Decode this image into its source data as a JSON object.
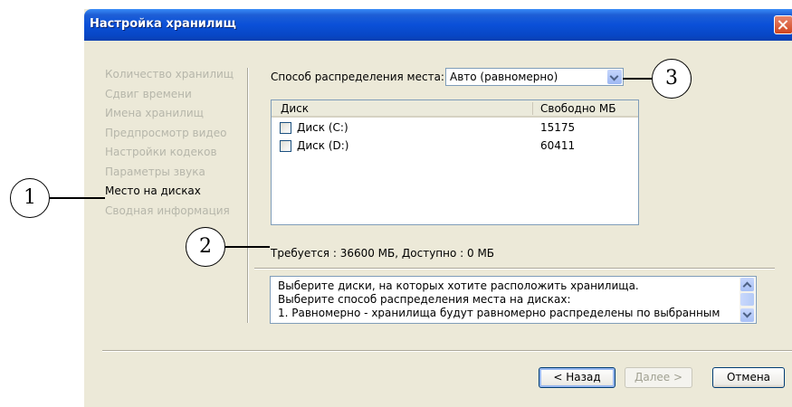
{
  "window": {
    "title": "Настройка хранилищ"
  },
  "steps": [
    {
      "label": "Количество хранилищ",
      "active": false
    },
    {
      "label": "Сдвиг времени",
      "active": false
    },
    {
      "label": "Имена хранилищ",
      "active": false
    },
    {
      "label": "Предпросмотр видео",
      "active": false
    },
    {
      "label": "Настройки кодеков",
      "active": false
    },
    {
      "label": "Параметры звука",
      "active": false
    },
    {
      "label": "Место на дисках",
      "active": true
    },
    {
      "label": "Сводная информация",
      "active": false
    }
  ],
  "distribution": {
    "label": "Способ распределения места:",
    "value": "Авто (равномерно)"
  },
  "disk_table": {
    "columns": [
      "Диск",
      "Свободно МБ"
    ],
    "rows": [
      {
        "name": "Диск (C:)",
        "free": "15175",
        "checked": false
      },
      {
        "name": "Диск (D:)",
        "free": "60411",
        "checked": false
      }
    ]
  },
  "status": "Требуется : 36600 МБ, Доступно : 0 МБ",
  "hint_lines": [
    "Выберите диски, на которых хотите расположить хранилища.",
    "Выберите способ распределения места на дисках:",
    "1. Равномерно - хранилища будут равномерно распределены по выбранным"
  ],
  "buttons": {
    "back": "< Назад",
    "next": "Далее >",
    "cancel": "Отмена"
  },
  "callouts": {
    "c1": "1",
    "c2": "2",
    "c3": "3"
  }
}
